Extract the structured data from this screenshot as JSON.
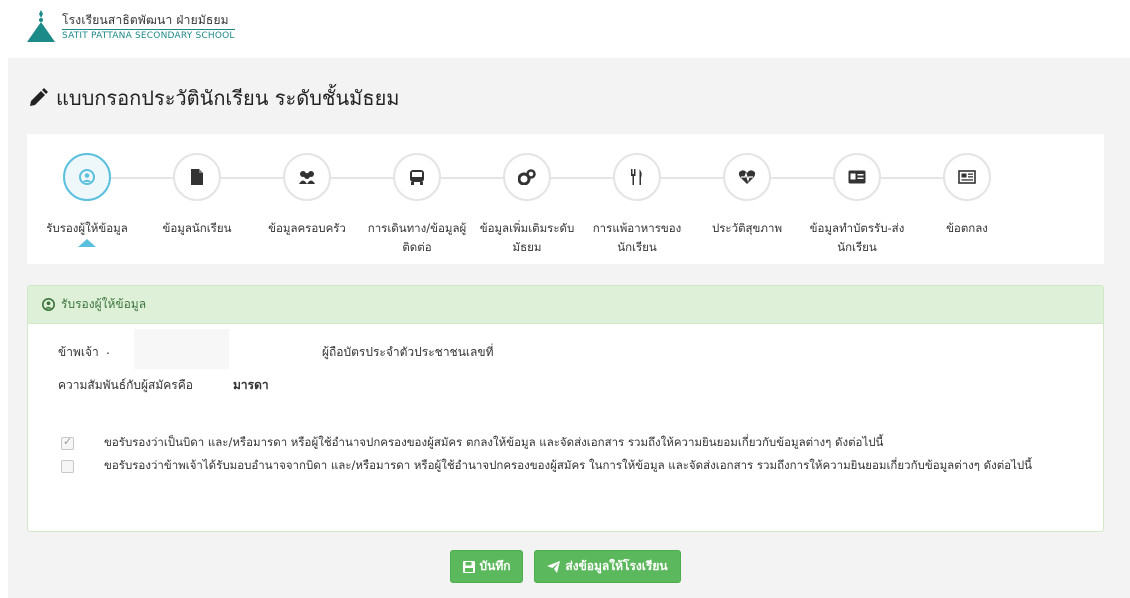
{
  "school": {
    "name_th": "โรงเรียนสาธิตพัฒนา ฝ่ายมัธยม",
    "name_en": "SATIT PATTANA SECONDARY SCHOOL"
  },
  "page": {
    "title": "แบบกรอกประวัตินักเรียน ระดับชั้นมัธยม",
    "title_icon": "pencil-icon"
  },
  "wizard": {
    "steps": [
      {
        "label": "รับรองผู้ให้ข้อมูล",
        "icon": "user-circle-icon",
        "active": true
      },
      {
        "label": "ข้อมูลนักเรียน",
        "icon": "file-icon",
        "active": false
      },
      {
        "label": "ข้อมูลครอบครัว",
        "icon": "users-icon",
        "active": false
      },
      {
        "label": "การเดินทาง/ข้อมูลผู้ติดต่อ",
        "icon": "bus-icon",
        "active": false
      },
      {
        "label": "ข้อมูลเพิ่มเติมระดับมัธยม",
        "icon": "cogs-icon",
        "active": false
      },
      {
        "label": "การแพ้อาหารของนักเรียน",
        "icon": "cutlery-icon",
        "active": false
      },
      {
        "label": "ประวัติสุขภาพ",
        "icon": "heartbeat-icon",
        "active": false
      },
      {
        "label": "ข้อมูลทำบัตรรับ-ส่งนักเรียน",
        "icon": "id-card-icon",
        "active": false
      },
      {
        "label": "ข้อตกลง",
        "icon": "newspaper-icon",
        "active": false
      }
    ]
  },
  "card": {
    "header": "รับรองผู้ให้ข้อมูล",
    "header_icon": "user-circle-icon",
    "i_label": "ข้าพเจ้า",
    "id_label": "ผู้ถือบัตรประจำตัวประชาชนเลขที่",
    "relation_label": "ความสัมพันธ์กับผู้สมัครคือ",
    "relation_value": "มารดา",
    "agreements": [
      {
        "text": "ขอรับรองว่าเป็นบิดา และ/หรือมารดา หรือผู้ใช้อำนาจปกครองของผู้สมัคร ตกลงให้ข้อมูล และจัดส่งเอกสาร รวมถึงให้ความยินยอมเกี่ยวกับข้อมูลต่างๆ ดังต่อไปนี้",
        "checked": true
      },
      {
        "text": "ขอรับรองว่าข้าพเจ้าได้รับมอบอำนาจจากบิดา และ/หรือมารดา หรือผู้ใช้อำนาจปกครองของผู้สมัคร ในการให้ข้อมูล และจัดส่งเอกสาร รวมถึงการให้ความยินยอมเกี่ยวกับข้อมูลต่างๆ ดังต่อไปนี้",
        "checked": false
      }
    ]
  },
  "buttons": {
    "save": "บันทึก",
    "save_icon": "floppy-disk-icon",
    "send": "ส่งข้อมูลให้โรงเรียน",
    "send_icon": "paper-plane-icon"
  },
  "colors": {
    "accent": "#5bc0de",
    "success": "#5cb85c",
    "panel_header_bg": "#dff0d8",
    "logo_teal": "#1d8a8a"
  }
}
